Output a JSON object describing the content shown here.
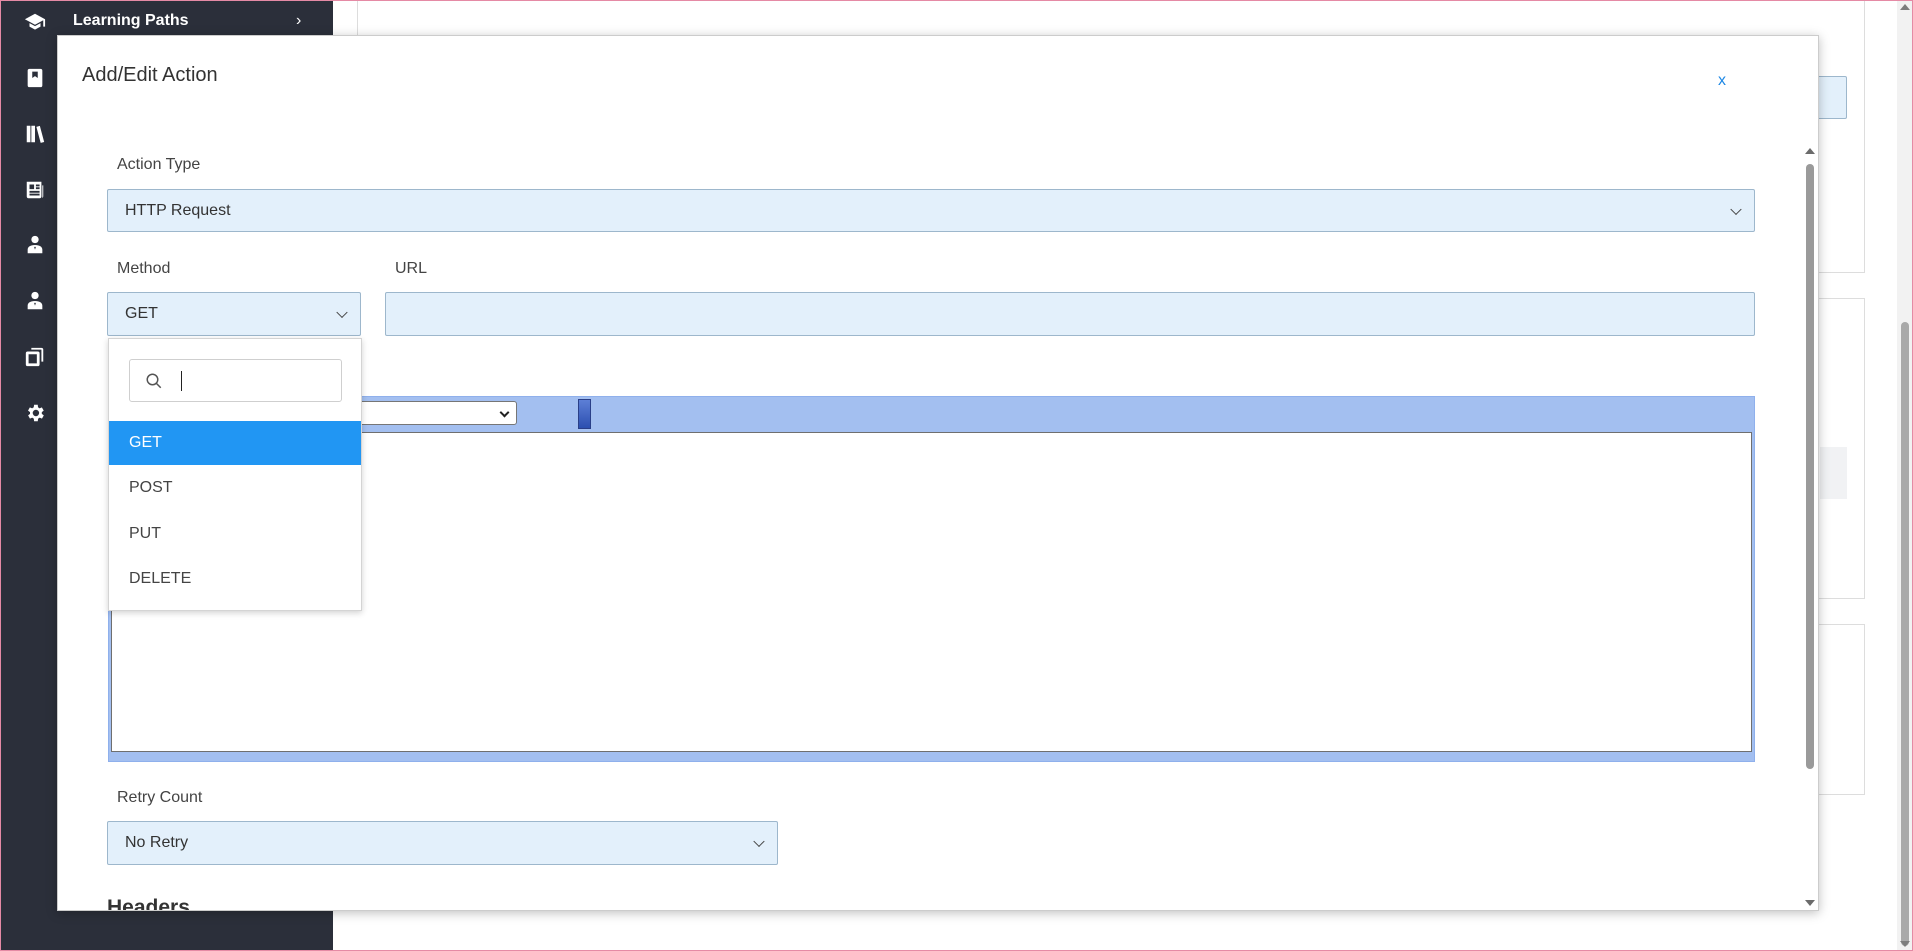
{
  "sidebar": {
    "top_item_label": "Learning Paths",
    "icons": [
      "graduation-cap-icon",
      "book-icon",
      "library-icon",
      "newspaper-icon",
      "user-icon",
      "user-alt-icon",
      "copy-icon",
      "gear-icon"
    ]
  },
  "modal": {
    "title": "Add/Edit Action",
    "close_label": "x",
    "action_type": {
      "label": "Action Type",
      "value": "HTTP Request"
    },
    "method": {
      "label": "Method",
      "value": "GET",
      "search_placeholder": "",
      "options": [
        "GET",
        "POST",
        "PUT",
        "DELETE"
      ],
      "selected_index": 0
    },
    "url": {
      "label": "URL",
      "value": ""
    },
    "retry_count": {
      "label": "Retry Count",
      "value": "No Retry"
    },
    "headers_heading": "Headers"
  },
  "colors": {
    "sidebar_bg": "#2b2f3a",
    "field_bg": "#e3f0fb",
    "accent": "#2196f3",
    "editor_toolbar": "#a3bff0",
    "close_link": "#1e88e5"
  }
}
